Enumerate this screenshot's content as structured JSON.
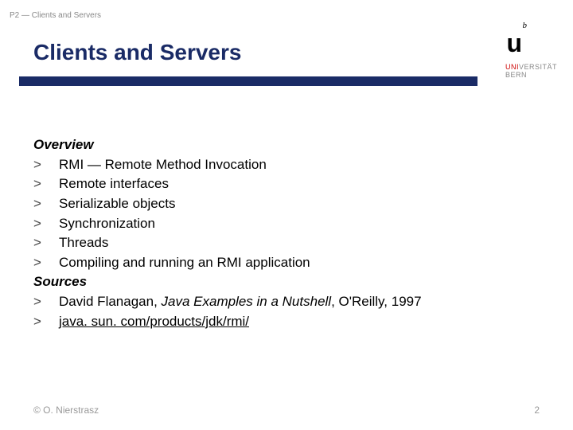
{
  "header": {
    "breadcrumb": "P2 — Clients and Servers",
    "title": "Clients and Servers"
  },
  "logo": {
    "big_u": "u",
    "sup_b": "b",
    "line1_red": "UNI",
    "line1_rest": "VERSITÄT",
    "line2": "BERN"
  },
  "body": {
    "overview_label": "Overview",
    "items": [
      "RMI — Remote Method Invocation",
      "Remote interfaces",
      "Serializable objects",
      "Synchronization",
      "Threads",
      "Compiling and running an RMI application"
    ],
    "sources_label": "Sources",
    "source1_pre": "David Flanagan, ",
    "source1_ital": "Java Examples in a Nutshell",
    "source1_post": ", O'Reilly, 1997",
    "source2": "java. sun. com/products/jdk/rmi/"
  },
  "footer": {
    "copyright": "© O. Nierstrasz",
    "page": "2"
  },
  "gt": ">"
}
